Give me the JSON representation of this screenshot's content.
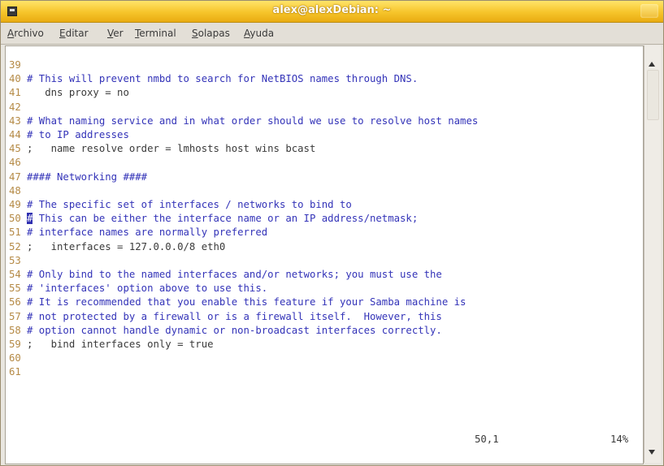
{
  "window": {
    "title": "alex@alexDebian: ~"
  },
  "menubar": {
    "items": [
      "Archivo",
      "Editar",
      "Ver",
      "Terminal",
      "Solapas",
      "Ayuda"
    ]
  },
  "lines": [
    {
      "num": "39",
      "text": "",
      "type": "code"
    },
    {
      "num": "40",
      "text": "# This will prevent nmbd to search for NetBIOS names through DNS.",
      "type": "comment"
    },
    {
      "num": "41",
      "text": "   dns proxy = no",
      "type": "code"
    },
    {
      "num": "42",
      "text": "",
      "type": "code"
    },
    {
      "num": "43",
      "text": "# What naming service and in what order should we use to resolve host names",
      "type": "comment"
    },
    {
      "num": "44",
      "text": "# to IP addresses",
      "type": "comment"
    },
    {
      "num": "45",
      "text": ";   name resolve order = lmhosts host wins bcast",
      "type": "code"
    },
    {
      "num": "46",
      "text": "",
      "type": "code"
    },
    {
      "num": "47",
      "text": "#### Networking ####",
      "type": "comment"
    },
    {
      "num": "48",
      "text": "",
      "type": "code"
    },
    {
      "num": "49",
      "text": "# The specific set of interfaces / networks to bind to",
      "type": "comment"
    },
    {
      "num": "50",
      "text": "# This can be either the interface name or an IP address/netmask;",
      "type": "comment",
      "cursor": true
    },
    {
      "num": "51",
      "text": "# interface names are normally preferred",
      "type": "comment"
    },
    {
      "num": "52",
      "text": ";   interfaces = 127.0.0.0/8 eth0",
      "type": "code"
    },
    {
      "num": "53",
      "text": "",
      "type": "code"
    },
    {
      "num": "54",
      "text": "# Only bind to the named interfaces and/or networks; you must use the",
      "type": "comment"
    },
    {
      "num": "55",
      "text": "# 'interfaces' option above to use this.",
      "type": "comment"
    },
    {
      "num": "56",
      "text": "# It is recommended that you enable this feature if your Samba machine is",
      "type": "comment"
    },
    {
      "num": "57",
      "text": "# not protected by a firewall or is a firewall itself.  However, this",
      "type": "comment"
    },
    {
      "num": "58",
      "text": "# option cannot handle dynamic or non-broadcast interfaces correctly.",
      "type": "comment"
    },
    {
      "num": "59",
      "text": ";   bind interfaces only = true",
      "type": "code"
    },
    {
      "num": "60",
      "text": "",
      "type": "code"
    },
    {
      "num": "61",
      "text": "",
      "type": "code"
    }
  ],
  "status": {
    "position": "50,1",
    "percent": "14%"
  },
  "colors": {
    "comment": "#3333b8",
    "line_number": "#b58a46",
    "titlebar": "#f6c42a"
  },
  "icons": {
    "window": "terminal-icon",
    "close": "close-icon",
    "scroll_up": "arrow-up-icon",
    "scroll_down": "arrow-down-icon"
  }
}
